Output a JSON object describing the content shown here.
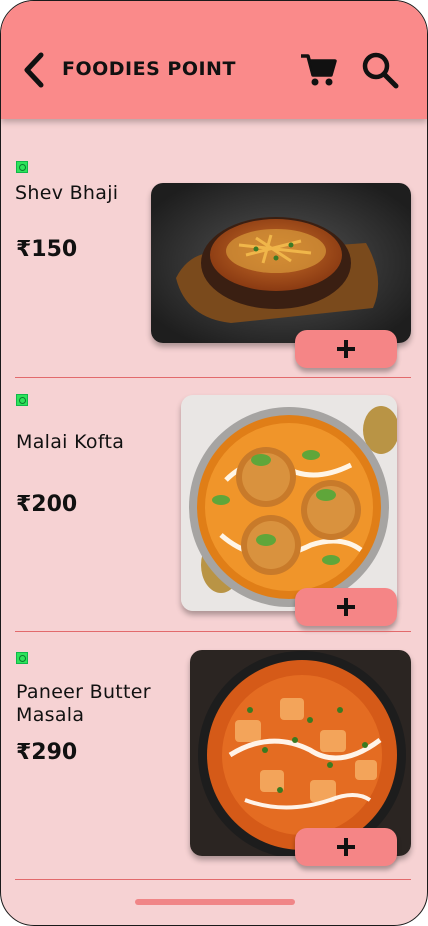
{
  "header": {
    "title": "FOODIES POINT",
    "icons": [
      "back-arrow-icon",
      "cart-icon",
      "search-icon"
    ],
    "bg_color": "#fa8a8a"
  },
  "items": [
    {
      "name": "Shev Bhaji",
      "price": "₹150",
      "image": "shev-bhaji-photo",
      "add_label": "+"
    },
    {
      "name": "Malai Kofta",
      "price": "₹200",
      "image": "malai-kofta-photo",
      "add_label": "+"
    },
    {
      "name": "Paneer Butter Masala",
      "price": "₹290",
      "image": "paneer-butter-masala-photo",
      "add_label": "+"
    }
  ],
  "colors": {
    "background": "#f6d2d3",
    "accent": "#f58586",
    "veg_badge": "#2ee35a"
  }
}
